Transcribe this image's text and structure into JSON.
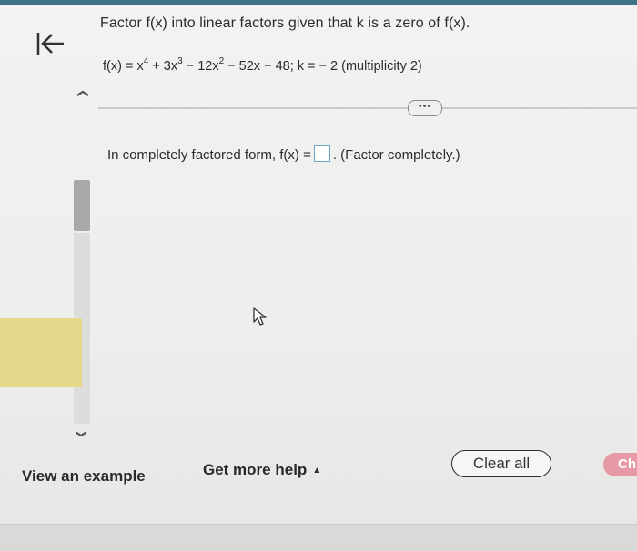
{
  "navigation": {
    "back_icon": "first-page-arrow-icon"
  },
  "question": {
    "prompt": "Factor f(x) into linear factors given that k is a zero of f(x).",
    "equation_parts": [
      "f(x) = x",
      "4",
      " + 3x",
      "3",
      " − 12x",
      "2",
      " − 52x − 48; k = − 2 (multiplicity 2)"
    ]
  },
  "more_button": {
    "label": "•••"
  },
  "answer": {
    "prefix": "In completely factored form, f(x) =",
    "suffix": ". (Factor completely.)",
    "input_value": ""
  },
  "scrollbar": {
    "up_icon": "chevron-up-icon",
    "down_icon": "chevron-down-icon"
  },
  "footer": {
    "view_example": "View an example",
    "get_help": "Get more help",
    "get_help_caret": "▲",
    "clear_all": "Clear all",
    "check_answer": "Ch"
  },
  "colors": {
    "accent_bar": "#3f7187",
    "answer_box_border": "#6fa4c7",
    "check_button": "#e79aa5",
    "side_panel": "#e6d98c"
  }
}
